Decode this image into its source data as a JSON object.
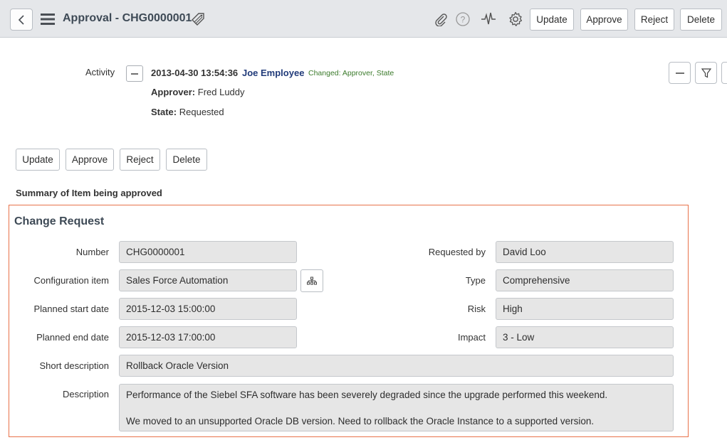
{
  "header": {
    "title": "Approval - CHG0000001",
    "buttons": {
      "update": "Update",
      "approve": "Approve",
      "reject": "Reject",
      "delete": "Delete"
    },
    "icons": [
      "back-icon",
      "menu-icon",
      "tag-icon",
      "attachment-icon",
      "help-icon",
      "activity-icon",
      "settings-icon"
    ]
  },
  "activity": {
    "label": "Activity",
    "timestamp": "2013-04-30 13:54:36",
    "user": "Joe Employee",
    "changed": "Changed:  Approver, State",
    "approver_label": "Approver:",
    "approver_value": "Fred Luddy",
    "state_label": "State:",
    "state_value": "Requested"
  },
  "form_buttons": {
    "update": "Update",
    "approve": "Approve",
    "reject": "Reject",
    "delete": "Delete"
  },
  "summary_heading": "Summary of Item being approved",
  "change_request": {
    "title": "Change Request",
    "number_label": "Number",
    "number": "CHG0000001",
    "ci_label": "Configuration item",
    "ci": "Sales Force Automation",
    "start_label": "Planned start date",
    "start": "2015-12-03 15:00:00",
    "end_label": "Planned end date",
    "end": "2015-12-03 17:00:00",
    "short_desc_label": "Short description",
    "short_desc": "Rollback Oracle Version",
    "desc_label": "Description",
    "desc_line1": "Performance of the Siebel SFA software has been severely degraded since the upgrade performed this weekend.",
    "desc_line2": "We moved to an unsupported Oracle DB version.   Need to rollback the Oracle Instance to a supported version.",
    "requested_by_label": "Requested by",
    "requested_by": "David Loo",
    "type_label": "Type",
    "type": "Comprehensive",
    "risk_label": "Risk",
    "risk": "High",
    "impact_label": "Impact",
    "impact": "3 - Low"
  },
  "colors": {
    "header_bg": "#e5e7ea",
    "highlight_border": "#e8724a",
    "user_link": "#213b7a",
    "changed_text": "#3a7a2a"
  }
}
